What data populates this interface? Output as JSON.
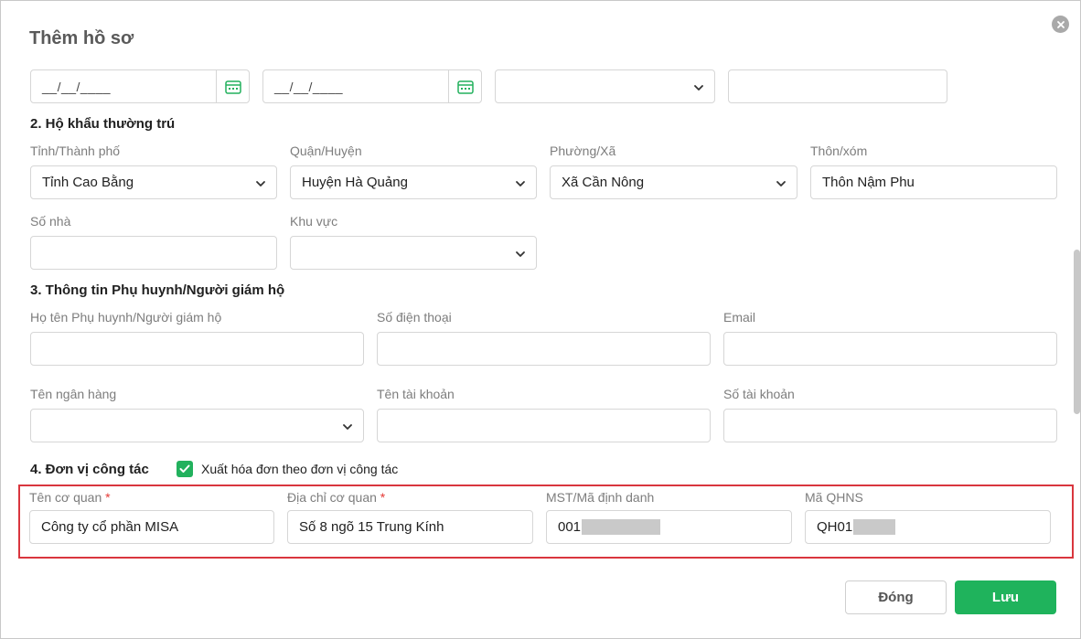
{
  "dialog": {
    "title": "Thêm hồ sơ"
  },
  "row0": {
    "date1": "__/__/____",
    "date2": "__/__/____",
    "select1": "",
    "text1": ""
  },
  "section2": {
    "title": "2. Hộ khẩu thường trú",
    "province_label": "Tỉnh/Thành phố",
    "province_value": "Tỉnh Cao Bằng",
    "district_label": "Quận/Huyện",
    "district_value": "Huyện Hà Quảng",
    "ward_label": "Phường/Xã",
    "ward_value": "Xã Cần Nông",
    "hamlet_label": "Thôn/xóm",
    "hamlet_value": "Thôn Nậm Phu",
    "house_label": "Số nhà",
    "house_value": "",
    "area_label": "Khu vực",
    "area_value": ""
  },
  "section3": {
    "title": "3. Thông tin Phụ huynh/Người giám hộ",
    "guardian_name_label": "Họ tên Phụ huynh/Người giám hộ",
    "phone_label": "Số điện thoại",
    "email_label": "Email",
    "bank_label": "Tên ngân hàng",
    "account_name_label": "Tên tài khoản",
    "account_no_label": "Số tài khoản"
  },
  "section4": {
    "title": "4. Đơn vị công tác",
    "invoice_checkbox_label": "Xuất hóa đơn theo đơn vị công tác",
    "invoice_checked": true,
    "org_name_label": "Tên cơ quan",
    "org_name_value": "Công ty cổ phần MISA",
    "org_address_label": "Địa chỉ cơ quan",
    "org_address_value": "Số 8 ngõ 15 Trung Kính",
    "tax_label": "MST/Mã định danh",
    "tax_value_prefix": "001",
    "budget_label": "Mã QHNS",
    "budget_value_prefix": "QH01",
    "required_mark": "*"
  },
  "footer": {
    "close_label": "Đóng",
    "save_label": "Lưu"
  },
  "colors": {
    "accent": "#1fb35c",
    "highlight_border": "#d9363e",
    "required": "#e53935"
  }
}
